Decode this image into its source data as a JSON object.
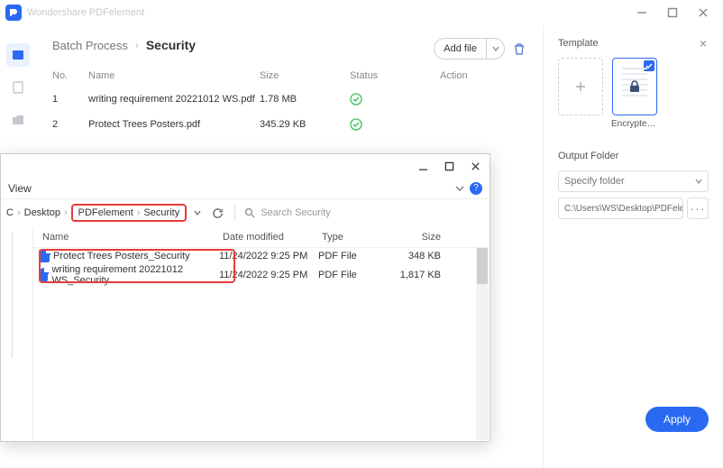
{
  "titlebar": {
    "app": "Wondershare PDFelement"
  },
  "breadcrumb": {
    "root": "Batch Process",
    "current": "Security"
  },
  "toolbar": {
    "add_file": "Add file"
  },
  "table": {
    "headers": {
      "no": "No.",
      "name": "Name",
      "size": "Size",
      "status": "Status",
      "action": "Action"
    },
    "rows": [
      {
        "no": "1",
        "name": "writing requirement 20221012 WS.pdf",
        "size": "1.78 MB"
      },
      {
        "no": "2",
        "name": "Protect Trees Posters.pdf",
        "size": "345.29 KB"
      }
    ]
  },
  "sidebar": {
    "template_label": "Template",
    "template_name": "Encrypted ...",
    "output_label": "Output Folder",
    "specify": "Specify folder",
    "path": "C:\\Users\\WS\\Desktop\\PDFelement\\Sec",
    "apply": "Apply"
  },
  "explorer": {
    "view": "View",
    "bc": {
      "level0": "C",
      "level1": "Desktop",
      "level2": "PDFelement",
      "level3": "Security"
    },
    "search_placeholder": "Search Security",
    "headers": {
      "name": "Name",
      "date": "Date modified",
      "type": "Type",
      "size": "Size"
    },
    "rows": [
      {
        "name": "Protect Trees Posters_Security",
        "date": "11/24/2022 9:25 PM",
        "type": "PDF File",
        "size": "348 KB"
      },
      {
        "name": "writing requirement 20221012 WS_Security",
        "date": "11/24/2022 9:25 PM",
        "type": "PDF File",
        "size": "1,817 KB"
      }
    ]
  }
}
